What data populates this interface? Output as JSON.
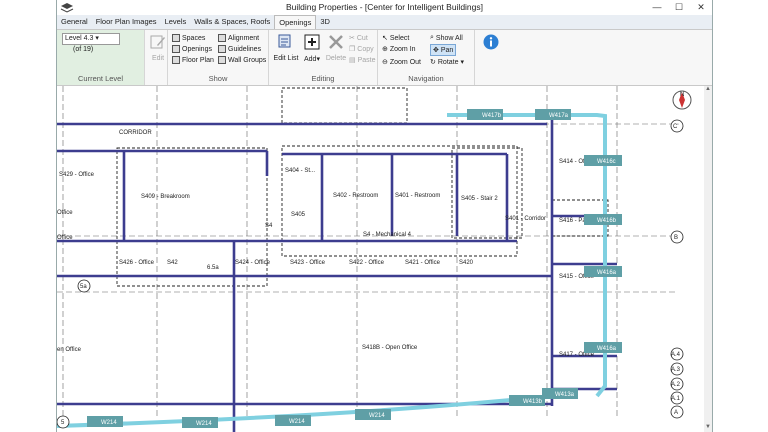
{
  "window": {
    "title": "Building Properties - [Center for Intelligent Buildings]",
    "minimize": "—",
    "maximize": "☐",
    "close": "✕"
  },
  "tabs": [
    "General",
    "Floor Plan Images",
    "Levels",
    "Walls & Spaces, Roofs",
    "Openings",
    "3D"
  ],
  "active_tab": "Openings",
  "ribbon": {
    "level_group": {
      "label": "Current Level",
      "selected": "Level 4.3",
      "count": "(of 19)"
    },
    "edit_label": "Edit",
    "show_group": {
      "label": "Show",
      "items": [
        "Spaces",
        "Openings",
        "Floor Plan",
        "Alignment",
        "Guidelines",
        "Wall Groups"
      ]
    },
    "editing_group": {
      "label": "Editing",
      "edit_list": "Edit List",
      "add": "Add",
      "delete": "Delete",
      "cut": "Cut",
      "copy": "Copy",
      "paste": "Paste"
    },
    "navigation_group": {
      "label": "Navigation",
      "select": "Select",
      "zoom_in": "Zoom In",
      "zoom_out": "Zoom Out",
      "show_all": "Show All",
      "pan": "Pan",
      "rotate": "Rotate"
    }
  },
  "colors": {
    "wall": "#3d3d8f",
    "window_tag": "#5f9fa6",
    "glazing": "#7fd0e0",
    "level_green": "#e1efe1"
  },
  "plan": {
    "rooms": [
      "S429 - Office",
      "S409 - Breakroom",
      "S404 - St...",
      "S402 - Restroom",
      "S401 - Restroom",
      "S405 - Stair 2",
      "S405",
      "S4",
      "S401 - Corridor",
      "S4 - Mechanical 4",
      "S426 - Office",
      "S42",
      "S424 - Office",
      "S423 - Office",
      "S422 - Office",
      "S421 - Office",
      "S420",
      "S414 - Office",
      "S416 - Pa...",
      "S415 - Office",
      "S417 - Office",
      "S418B - Open Office",
      "Office",
      "Office",
      "en Office",
      "CORRIDOR",
      "6.5a"
    ],
    "windows": [
      "W417b",
      "W417a",
      "W416c",
      "W416b",
      "W416a",
      "W416a",
      "W413b",
      "W413a",
      "W214",
      "W214",
      "W214",
      "W214"
    ],
    "grid_bubbles": [
      "C'",
      "B",
      "A.4",
      "A.3",
      "A.2",
      "A.1",
      "A",
      "5a",
      "5"
    ],
    "compass": "N"
  }
}
